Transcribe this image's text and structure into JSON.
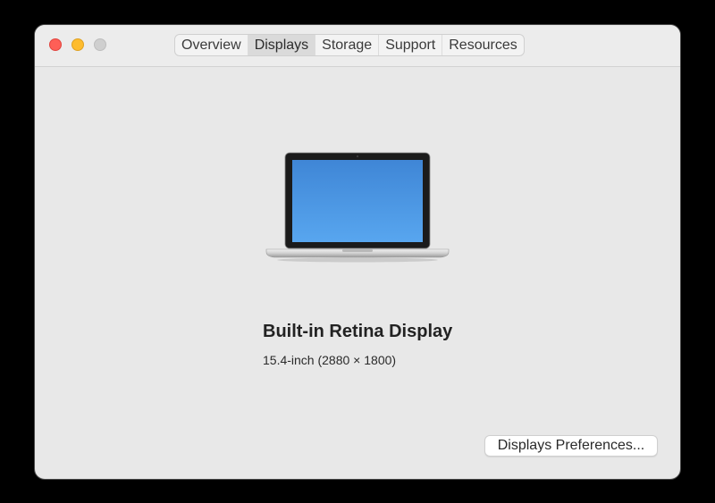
{
  "window": {
    "traffic_lights": [
      "close",
      "minimize",
      "zoom"
    ]
  },
  "tabs": [
    {
      "label": "Overview",
      "selected": false
    },
    {
      "label": "Displays",
      "selected": true
    },
    {
      "label": "Storage",
      "selected": false
    },
    {
      "label": "Support",
      "selected": false
    },
    {
      "label": "Resources",
      "selected": false
    }
  ],
  "display": {
    "icon": "laptop-icon",
    "name": "Built-in Retina Display",
    "spec": "15.4-inch (2880 × 1800)"
  },
  "buttons": {
    "preferences_label": "Displays Preferences..."
  },
  "colors": {
    "close": "#fe5f57",
    "minimize": "#febc2e",
    "zoom": "#cfcfcf",
    "screen_blue": "#4a90d9"
  }
}
